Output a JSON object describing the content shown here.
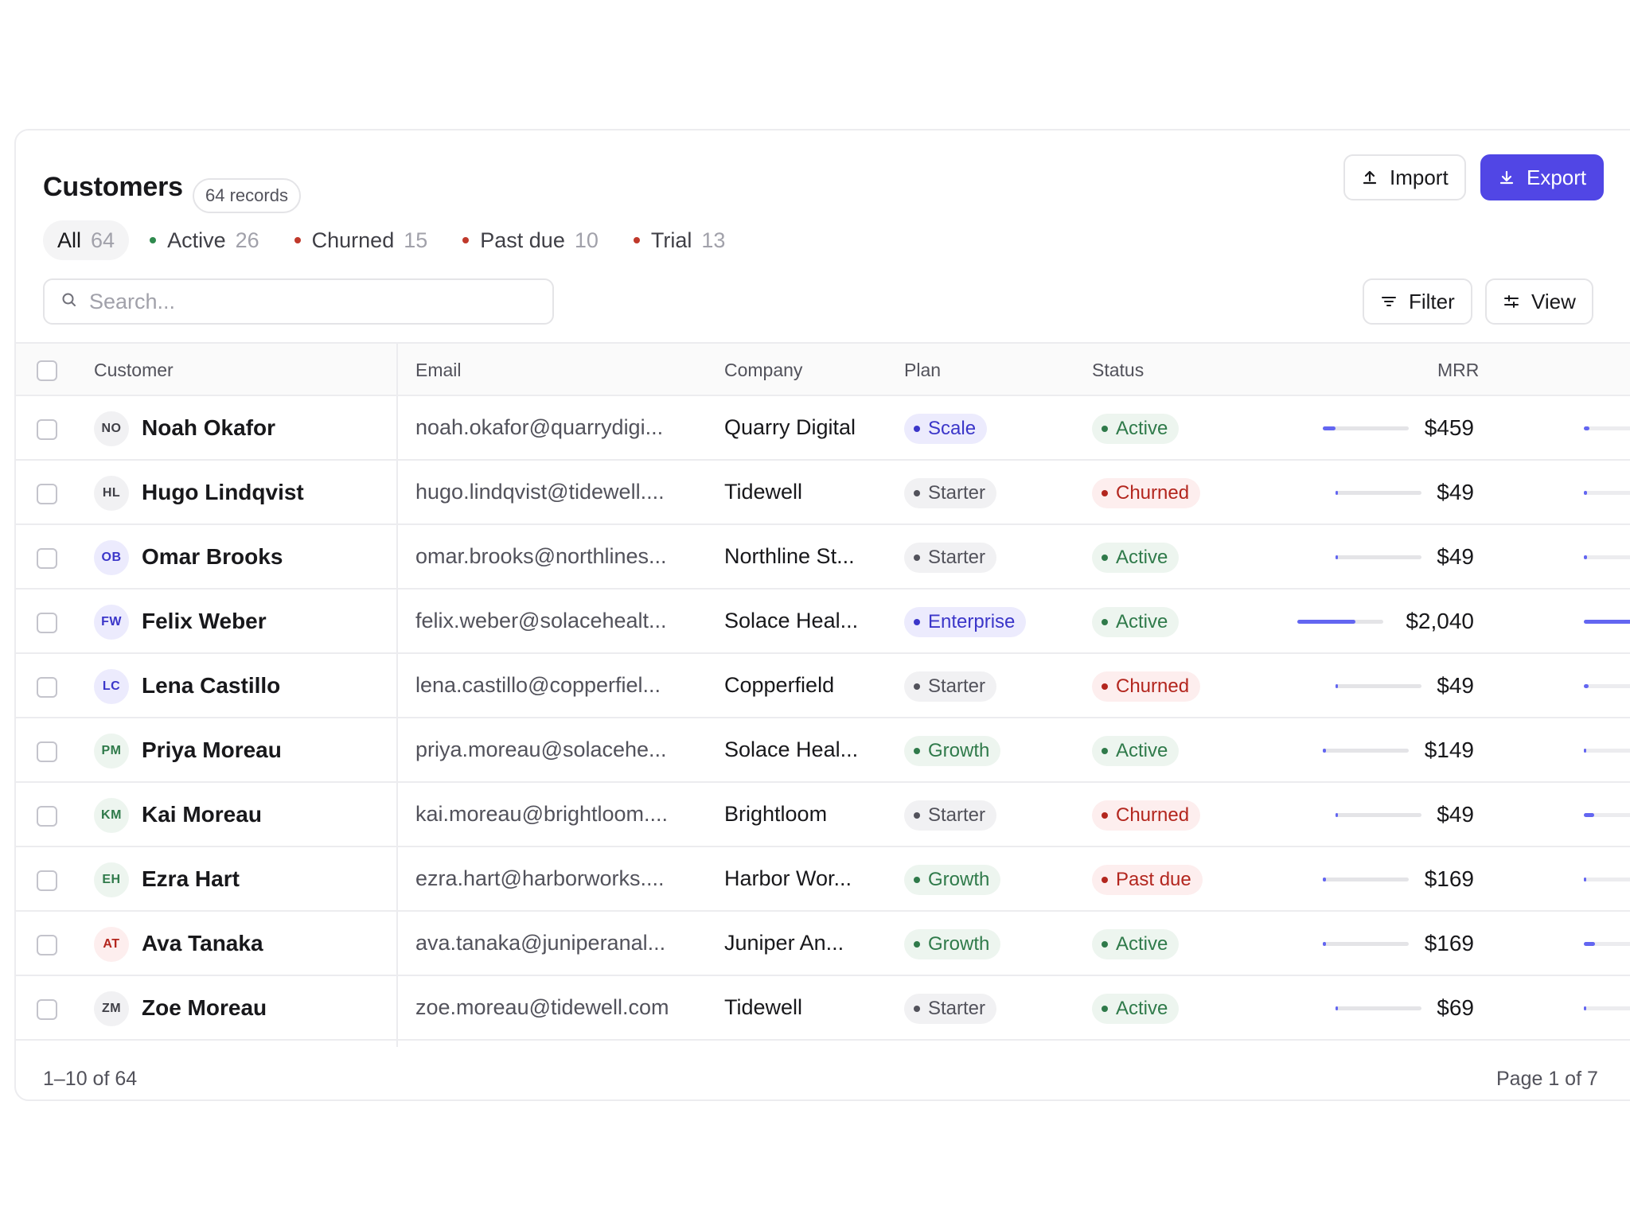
{
  "header": {
    "title": "Customers",
    "records_label": "64 records",
    "import_label": "Import",
    "export_label": "Export"
  },
  "tabs": [
    {
      "label": "All",
      "count": "64",
      "dot_color": ""
    },
    {
      "label": "Active",
      "count": "26",
      "dot_color": "#2f8a4e"
    },
    {
      "label": "Churned",
      "count": "15",
      "dot_color": "#c0392b"
    },
    {
      "label": "Past due",
      "count": "10",
      "dot_color": "#c0392b"
    },
    {
      "label": "Trial",
      "count": "13",
      "dot_color": "#c0392b"
    }
  ],
  "search": {
    "placeholder": "Search..."
  },
  "toolbar": {
    "filter_label": "Filter",
    "view_label": "View"
  },
  "columns": {
    "customer": "Customer",
    "email": "Email",
    "company": "Company",
    "plan": "Plan",
    "status": "Status",
    "mrr": "MRR"
  },
  "colors": {
    "accent": "#5146e5",
    "plan_scale_bg": "#ecebfd",
    "plan_scale_fg": "#3b36c9",
    "plan_starter_bg": "#f1f1f3",
    "plan_starter_fg": "#52525b",
    "plan_growth_bg": "#edf5ef",
    "plan_growth_fg": "#2f7a4a",
    "status_active_bg": "#edf5ef",
    "status_active_fg": "#2f7a4a",
    "status_churned_bg": "#fdeeee",
    "status_churned_fg": "#b3261e"
  },
  "rows": [
    {
      "initials": "NO",
      "name": "Noah Okafor",
      "email": "noah.okafor@quarrydigi...",
      "company": "Quarry Digital",
      "plan": "Scale",
      "status": "Active",
      "mrr": "$459",
      "mrr_fraction": 0.15,
      "spark_fraction": 0.1
    },
    {
      "initials": "HL",
      "name": "Hugo Lindqvist",
      "email": "hugo.lindqvist@tidewell....",
      "company": "Tidewell",
      "plan": "Starter",
      "status": "Churned",
      "mrr": "$49",
      "mrr_fraction": 0.02,
      "spark_fraction": 0.05
    },
    {
      "initials": "OB",
      "name": "Omar Brooks",
      "email": "omar.brooks@northlines...",
      "company": "Northline St...",
      "plan": "Starter",
      "status": "Active",
      "mrr": "$49",
      "mrr_fraction": 0.02,
      "spark_fraction": 0.05
    },
    {
      "initials": "FW",
      "name": "Felix Weber",
      "email": "felix.weber@solacehealt...",
      "company": "Solace Heal...",
      "plan": "Enterprise",
      "status": "Active",
      "mrr": "$2,040",
      "mrr_fraction": 0.68,
      "spark_fraction": 0.85
    },
    {
      "initials": "LC",
      "name": "Lena Castillo",
      "email": "lena.castillo@copperfiel...",
      "company": "Copperfield",
      "plan": "Starter",
      "status": "Churned",
      "mrr": "$49",
      "mrr_fraction": 0.02,
      "spark_fraction": 0.08
    },
    {
      "initials": "PM",
      "name": "Priya Moreau",
      "email": "priya.moreau@solacehe...",
      "company": "Solace Heal...",
      "plan": "Growth",
      "status": "Active",
      "mrr": "$149",
      "mrr_fraction": 0.04,
      "spark_fraction": 0.03
    },
    {
      "initials": "KM",
      "name": "Kai Moreau",
      "email": "kai.moreau@brightloom....",
      "company": "Brightloom",
      "plan": "Starter",
      "status": "Churned",
      "mrr": "$49",
      "mrr_fraction": 0.02,
      "spark_fraction": 0.18
    },
    {
      "initials": "EH",
      "name": "Ezra Hart",
      "email": "ezra.hart@harborworks....",
      "company": "Harbor Wor...",
      "plan": "Growth",
      "status": "Past due",
      "mrr": "$169",
      "mrr_fraction": 0.04,
      "spark_fraction": 0.0
    },
    {
      "initials": "AT",
      "name": "Ava Tanaka",
      "email": "ava.tanaka@juniperanal...",
      "company": "Juniper An...",
      "plan": "Growth",
      "status": "Active",
      "mrr": "$169",
      "mrr_fraction": 0.04,
      "spark_fraction": 0.2
    },
    {
      "initials": "ZM",
      "name": "Zoe Moreau",
      "email": "zoe.moreau@tidewell.com",
      "company": "Tidewell",
      "plan": "Starter",
      "status": "Active",
      "mrr": "$69",
      "mrr_fraction": 0.02,
      "spark_fraction": 0.03
    }
  ],
  "footer": {
    "range": "1–10 of 64",
    "page": "Page 1 of 7"
  }
}
